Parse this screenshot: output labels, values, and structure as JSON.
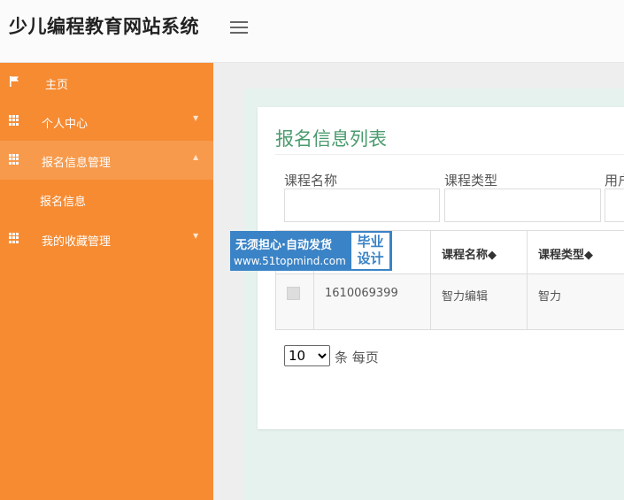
{
  "header": {
    "title": "少儿编程教育网站系统"
  },
  "sidebar": {
    "items": [
      {
        "label": "主页"
      },
      {
        "label": "个人中心"
      },
      {
        "label": "报名信息管理"
      },
      {
        "label": "我的收藏管理"
      }
    ],
    "sub_item": "报名信息"
  },
  "main": {
    "card_title": "报名信息列表",
    "filters": [
      {
        "label": "课程名称",
        "value": ""
      },
      {
        "label": "课程类型",
        "value": ""
      },
      {
        "label": "用户",
        "value": ""
      }
    ],
    "table": {
      "headers": [
        "课程名称◆",
        "课程类型◆"
      ],
      "rows": [
        {
          "id": "1610069399",
          "course_name": "智力编辑",
          "course_type": "智力"
        }
      ]
    },
    "pagination": {
      "page_size": "10",
      "suffix": "条 每页"
    }
  },
  "watermark": {
    "line1": "无须担心·自动发货",
    "line2": "www.51topmind.com",
    "box_line1": "毕业",
    "box_line2": "设计"
  },
  "colors": {
    "sidebar": "#f68b32",
    "accent_green": "#4a9b6e",
    "watermark_blue": "#3a83c6"
  }
}
